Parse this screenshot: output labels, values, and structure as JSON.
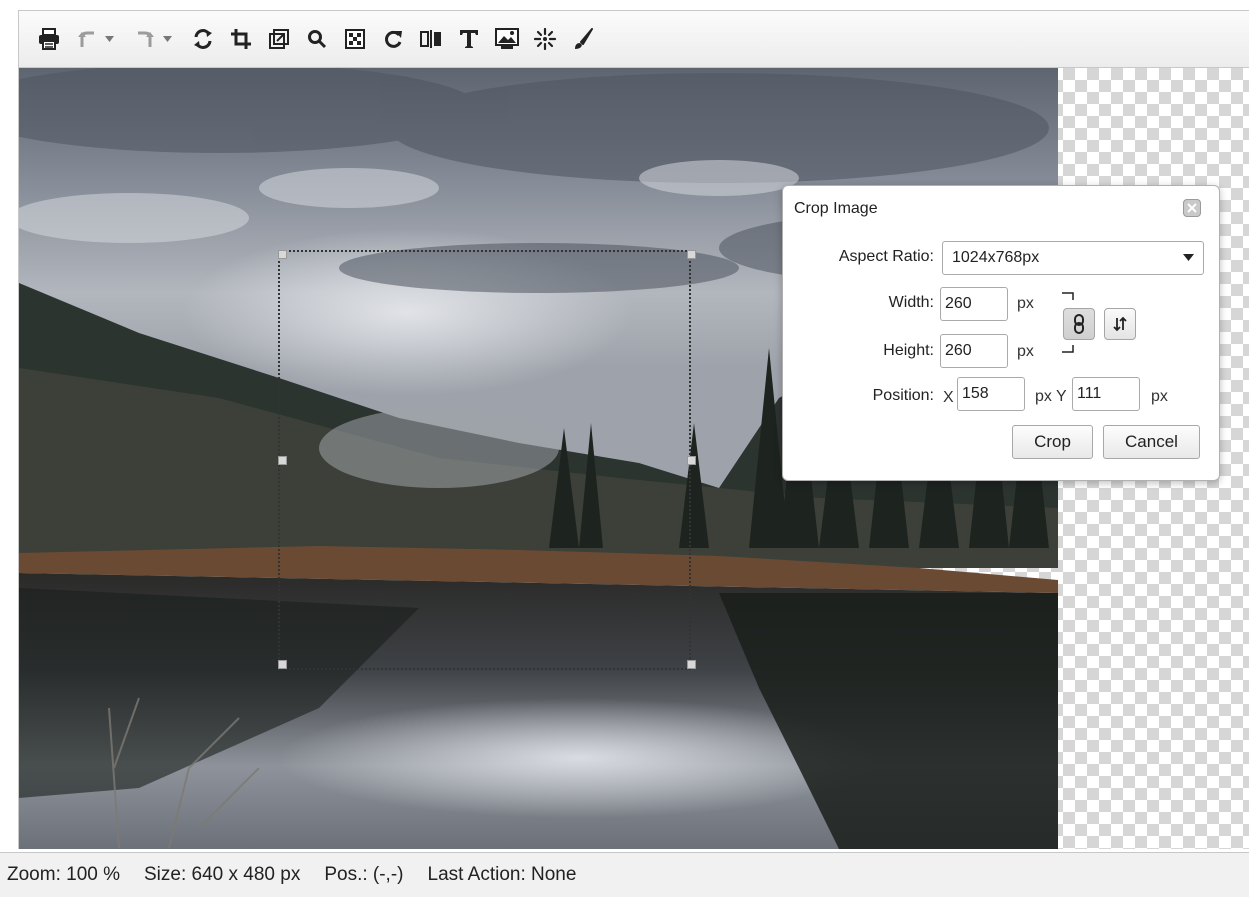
{
  "toolbar": {
    "items": [
      {
        "name": "print-icon",
        "label": "Print"
      },
      {
        "name": "undo-icon",
        "label": "Undo"
      },
      {
        "name": "redo-icon",
        "label": "Redo"
      },
      {
        "name": "revert-icon",
        "label": "Revert"
      },
      {
        "name": "crop-icon",
        "label": "Crop"
      },
      {
        "name": "resize-icon",
        "label": "Resize"
      },
      {
        "name": "zoom-icon",
        "label": "Zoom"
      },
      {
        "name": "filter-icon",
        "label": "Filter"
      },
      {
        "name": "rotate-icon",
        "label": "Rotate"
      },
      {
        "name": "flip-icon",
        "label": "Flip"
      },
      {
        "name": "text-icon",
        "label": "Text"
      },
      {
        "name": "insert-image-icon",
        "label": "Insert image"
      },
      {
        "name": "effects-icon",
        "label": "Effects"
      },
      {
        "name": "paint-brush-icon",
        "label": "Draw"
      }
    ]
  },
  "dialog": {
    "title": "Crop Image",
    "aspect_ratio_label": "Aspect Ratio:",
    "aspect_ratio_value": "1024x768px",
    "width_label": "Width:",
    "width_value": "260",
    "height_label": "Height:",
    "height_value": "260",
    "unit_px": "px",
    "position_label": "Position:",
    "x_label": "X",
    "x_value": "158",
    "px_y_label": "px Y",
    "y_value": "111",
    "crop_button": "Crop",
    "cancel_button": "Cancel"
  },
  "status": {
    "zoom": "Zoom:  100 %",
    "size": "Size:  640 x 480 px",
    "pos": "Pos.: (-,-)",
    "last_action": "Last Action: None"
  }
}
